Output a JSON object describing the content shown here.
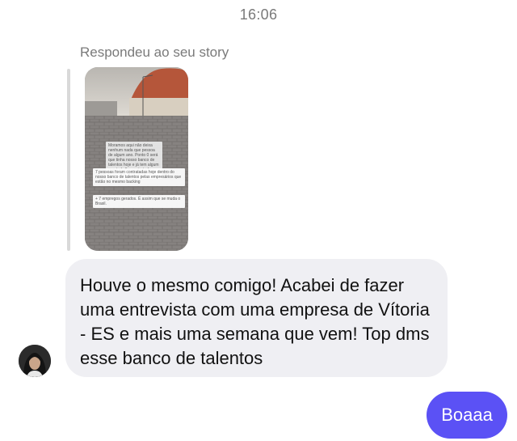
{
  "chat": {
    "timestamp": "16:06",
    "reply_label": "Respondeu ao seu story",
    "story": {
      "captions": [
        "Moramos aqui não deixa nenhum nada que pessoa de algum ano. Ponto 0 será que tinha nosso banco de talentos hoje e já tem algum que trabalhe contratado. Mais uma gota de água!",
        "7 pessoas foram contratadas hoje dentro do nosso banco de talentos pelas empresários que estão no mesmo backing",
        "+ 7 empregos gerados. É assim que se muda o Brasil."
      ]
    },
    "incoming_message": "Houve o mesmo comigo! Acabei de fazer uma entrevista com uma empresa de Vítoria - ES e mais uma semana que vem! Top dms esse banco de talentos",
    "outgoing_message": "Boaaa"
  }
}
